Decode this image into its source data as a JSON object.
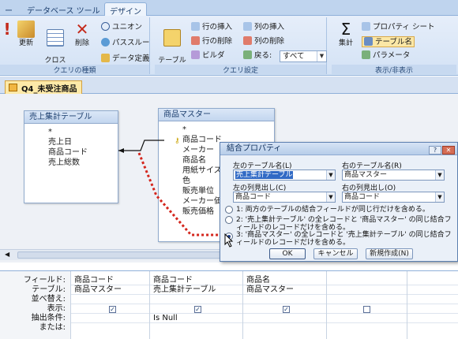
{
  "ribbon": {
    "tabs": [
      "ー",
      "データベース ツール",
      "デザイン"
    ],
    "groups": {
      "query_type": {
        "label": "クエリの種類",
        "buttons": [
          "!",
          "更新",
          "クロス\n集計",
          "削除",
          "ユニオン",
          "パススルー",
          "データ定義"
        ]
      },
      "query_setup": {
        "label": "クエリ設定",
        "table_display": "テーブル\nの表示",
        "insert_row": "行の挿入",
        "delete_row": "行の削除",
        "builder": "ビルダ",
        "insert_col": "列の挿入",
        "delete_col": "列の削除",
        "return_label": "戻る:",
        "return_value": "すべて"
      },
      "show_hide": {
        "label": "表示/非表示",
        "totals": "集計",
        "property_sheet": "プロパティ シート",
        "table_names": "テーブル名",
        "parameters": "パラメータ"
      }
    }
  },
  "document": {
    "tab_title": "Q4_未受注商品"
  },
  "tables": {
    "left": {
      "title": "売上集計テーブル",
      "fields": [
        "*",
        "売上日",
        "商品コード",
        "売上総数"
      ]
    },
    "right": {
      "title": "商品マスター",
      "fields": [
        "*",
        "商品コード",
        "メーカー",
        "商品名",
        "用紙サイズ",
        "色",
        "販売単位",
        "メーカー価格",
        "販売価格"
      ]
    }
  },
  "dialog": {
    "title": "結合プロパティ",
    "left_table_label": "左のテーブル名(L)",
    "left_table_value": "売上集計テーブル",
    "right_table_label": "右のテーブル名(R)",
    "right_table_value": "商品マスター",
    "left_col_label": "左の列見出し(C)",
    "left_col_value": "商品コード",
    "right_col_label": "右の列見出し(O)",
    "right_col_value": "商品コード",
    "options": [
      {
        "num": "1:",
        "text": "両方のテーブルの結合フィールドが同じ行だけを含める。"
      },
      {
        "num": "2:",
        "text": "'売上集計テーブル' の全レコードと '商品マスター' の同じ結合フィールドのレコードだけを含める。"
      },
      {
        "num": "3:",
        "text": "'商品マスター' の全レコードと '売上集計テーブル' の同じ結合フィールドのレコードだけを含める。"
      }
    ],
    "selected_option": 3,
    "ok": "OK",
    "cancel": "キャンセル",
    "new": "新規作成(N)"
  },
  "grid": {
    "row_labels": [
      "フィールド:",
      "テーブル:",
      "並べ替え:",
      "表示:",
      "抽出条件:",
      "または:"
    ],
    "columns": [
      {
        "field": "商品コード",
        "table": "商品マスター",
        "show": true,
        "criteria": ""
      },
      {
        "field": "商品コード",
        "table": "売上集計テーブル",
        "show": true,
        "criteria": "Is Null"
      },
      {
        "field": "商品名",
        "table": "商品マスター",
        "show": true,
        "criteria": ""
      },
      {
        "field": "",
        "table": "",
        "show": false,
        "criteria": ""
      }
    ]
  },
  "colors": {
    "join_arrow": "#d4261d",
    "ribbon_bg": "#dbe7f7",
    "doc_tab": "#fde9a8"
  }
}
